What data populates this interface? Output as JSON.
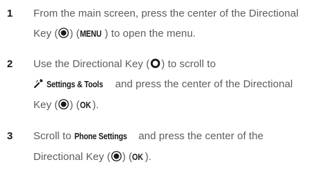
{
  "steps": [
    {
      "number": "1",
      "text_a": "From the main screen, press the center of the Directional Key (",
      "text_b": ") (",
      "key_label": "MENU",
      "text_c": ") to open the menu."
    },
    {
      "number": "2",
      "text_a": "Use the Directional Key (",
      "text_b": ") to scroll to",
      "menu_item": "Settings & Tools",
      "text_c": " and press the center of the Directional Key (",
      "text_d": ") (",
      "key_label": "OK",
      "text_e": ")."
    },
    {
      "number": "3",
      "text_a": "Scroll to ",
      "menu_item": "Phone Settings",
      "text_b": " and press the center of the Directional Key (",
      "text_c": ") (",
      "key_label": "OK",
      "text_d": ")."
    }
  ],
  "icons": {
    "directional_key_center": "directional-key-center-pressed-icon",
    "directional_key_ring": "directional-key-ring-icon",
    "settings_tools": "settings-tools-icon"
  }
}
